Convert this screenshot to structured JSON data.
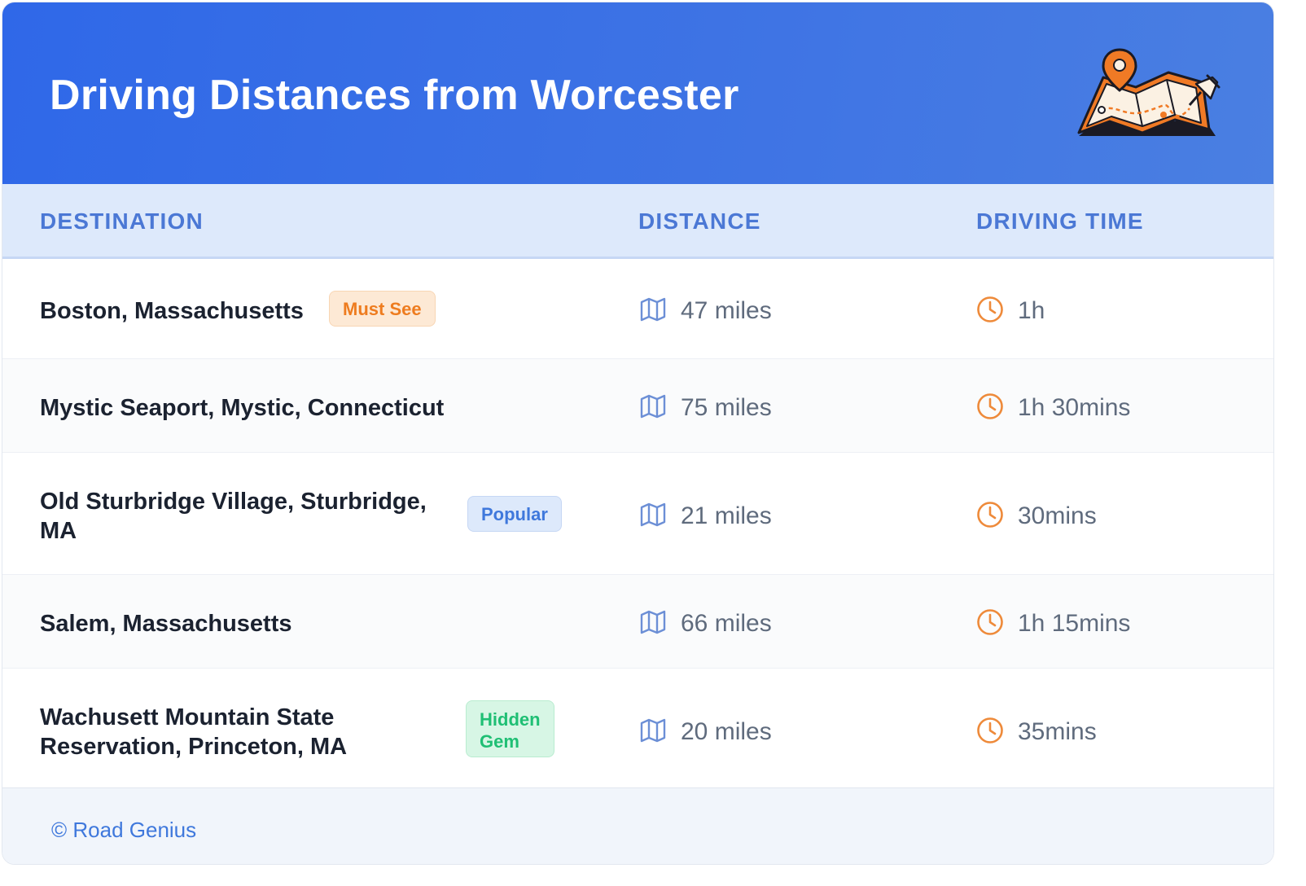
{
  "header": {
    "title": "Driving Distances from Worcester",
    "illustration_icon": "map-with-pin-illustration"
  },
  "table": {
    "columns": [
      "DESTINATION",
      "DISTANCE",
      "DRIVING TIME"
    ],
    "rows": [
      {
        "destination": "Boston, Massachusetts",
        "badge": "Must See",
        "distance": "47 miles",
        "time": "1h"
      },
      {
        "destination": "Mystic Seaport, Mystic, Connecticut",
        "badge": "",
        "distance": "75 miles",
        "time": "1h 30mins"
      },
      {
        "destination_line1": "Old Sturbridge Village, Sturbridge,",
        "destination_line2": "MA",
        "badge": "Popular",
        "distance": "21 miles",
        "time": "30mins"
      },
      {
        "destination": "Salem, Massachusetts",
        "badge": "",
        "distance": "66 miles",
        "time": "1h 15mins"
      },
      {
        "destination_line1": "Wachusett Mountain State",
        "destination_line2": "Reservation, Princeton, MA",
        "badge_line1": "Hidden",
        "badge_line2": "Gem",
        "distance": "20 miles",
        "time": "35mins"
      }
    ],
    "icons": {
      "distance": "map-icon",
      "time": "clock-icon"
    }
  },
  "footer": {
    "credit": "© Road Genius"
  },
  "colors": {
    "header_start": "#2f68e8",
    "header_end": "#4a7fe2",
    "column_header_bg": "#dde9fb",
    "column_header_text": "#4b78d5",
    "must_see": "#ee7c1f",
    "popular": "#3f78dc",
    "hidden_gem": "#1fbf74",
    "clock": "#ee8a3a",
    "map_icon": "#6c8fd6"
  }
}
